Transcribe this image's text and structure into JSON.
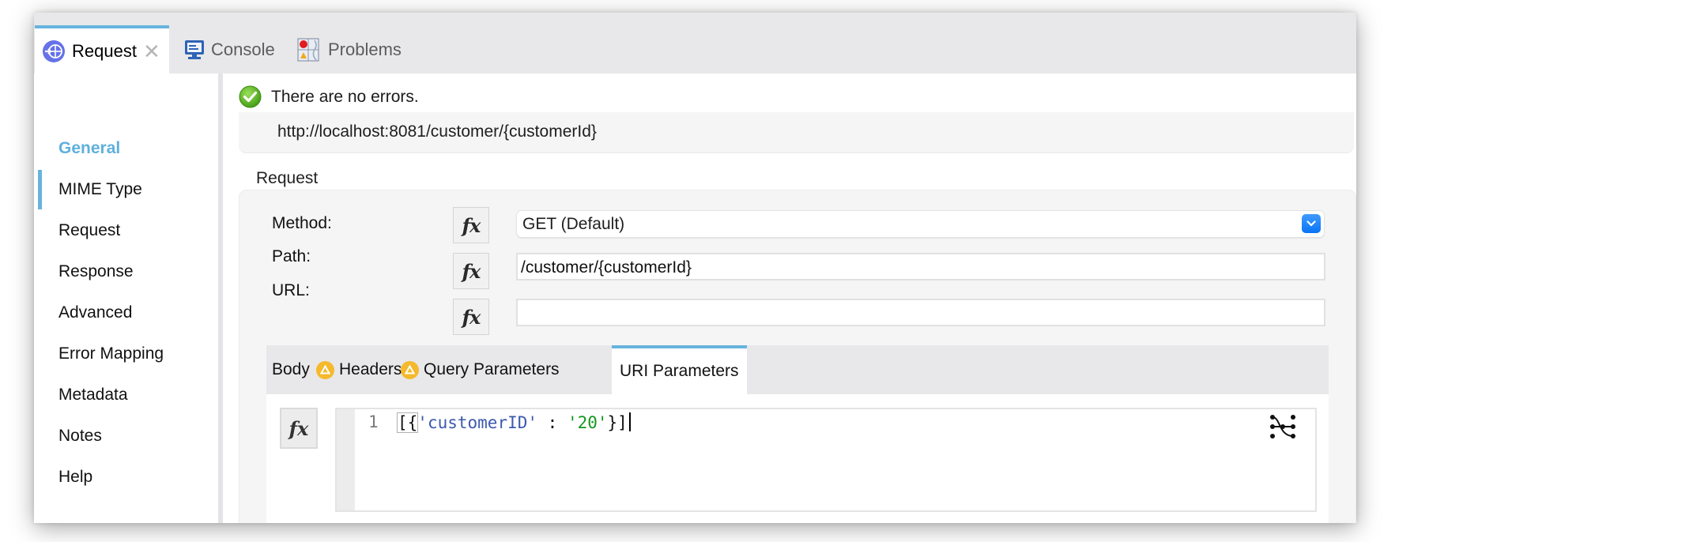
{
  "tabs": [
    {
      "label": "Request",
      "icon": "request-globe-icon",
      "active": true,
      "closable": true
    },
    {
      "label": "Console",
      "icon": "console-monitor-icon",
      "active": false
    },
    {
      "label": "Problems",
      "icon": "problems-icon",
      "active": false
    }
  ],
  "sidebar": {
    "items": [
      {
        "label": "General",
        "active": true
      },
      {
        "label": "MIME Type"
      },
      {
        "label": "Request"
      },
      {
        "label": "Response"
      },
      {
        "label": "Advanced"
      },
      {
        "label": "Error Mapping"
      },
      {
        "label": "Metadata"
      },
      {
        "label": "Notes"
      },
      {
        "label": "Help"
      }
    ]
  },
  "status": {
    "message": "There are no errors.",
    "icon": "check-circle-icon"
  },
  "url_preview": "http://localhost:8081/customer/{customerId}",
  "request_section": {
    "title": "Request",
    "method": {
      "label": "Method:",
      "value": "GET (Default)"
    },
    "path": {
      "label": "Path:",
      "value": "/customer/{customerId}"
    },
    "url": {
      "label": "URL:",
      "value": ""
    },
    "fx_label": "fx",
    "inner_tabs": [
      {
        "label": "Body",
        "warning": false
      },
      {
        "label": "Headers",
        "warning": true
      },
      {
        "label": "Query Parameters",
        "warning": true
      },
      {
        "label": "URI Parameters",
        "active": true
      }
    ],
    "editor": {
      "line_number": "1",
      "tokens": {
        "open": "[{",
        "key": "'customerID'",
        "sep": " : ",
        "value": "'20'",
        "close": "}]"
      }
    }
  },
  "colors": {
    "accent": "#67b3de",
    "warning": "#f5b92b",
    "dropdown": "#0a74f5",
    "code_key": "#3d59b0",
    "code_string": "#14961e"
  }
}
